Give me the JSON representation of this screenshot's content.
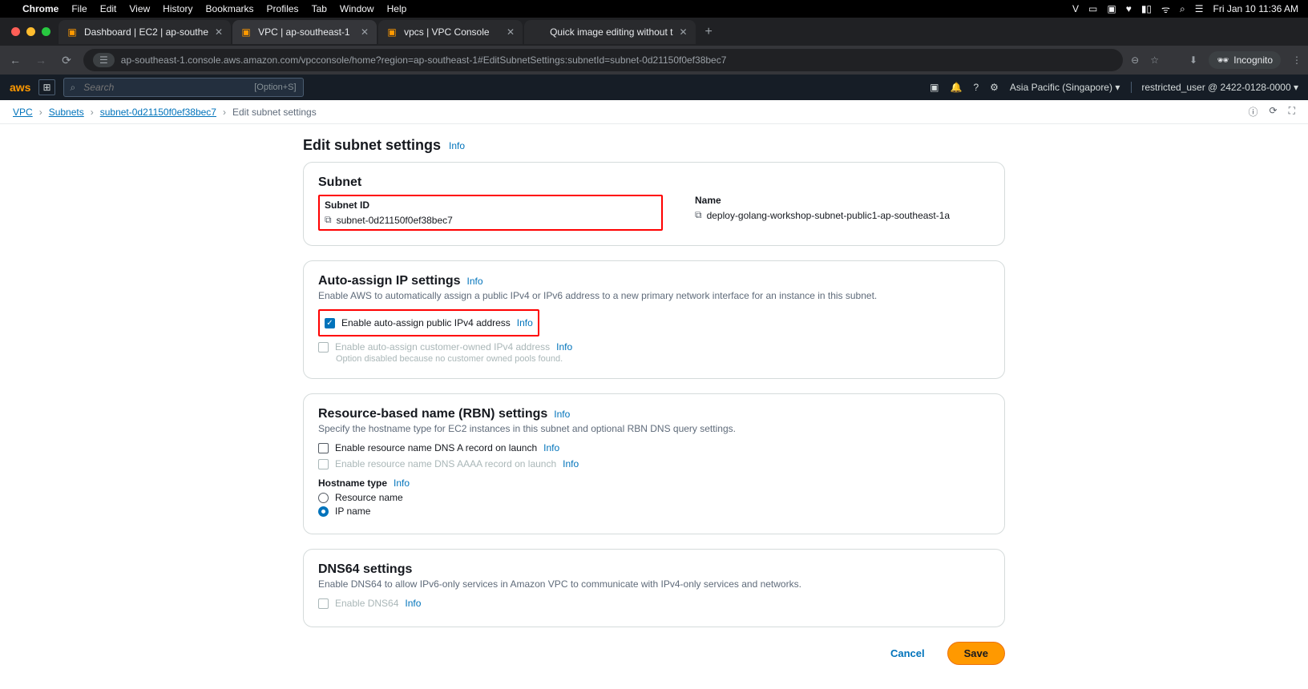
{
  "mac_menu": {
    "app_name": "Chrome",
    "items": [
      "File",
      "Edit",
      "View",
      "History",
      "Bookmarks",
      "Profiles",
      "Tab",
      "Window",
      "Help"
    ],
    "clock": "Fri Jan 10  11:36 AM"
  },
  "chrome": {
    "tabs": [
      {
        "title": "Dashboard | EC2 | ap-southe"
      },
      {
        "title": "VPC | ap-southeast-1"
      },
      {
        "title": "vpcs | VPC Console"
      },
      {
        "title": "Quick image editing without t"
      }
    ],
    "url": "ap-southeast-1.console.aws.amazon.com/vpcconsole/home?region=ap-southeast-1#EditSubnetSettings:subnetId=subnet-0d21150f0ef38bec7",
    "incognito_label": "Incognito"
  },
  "aws_header": {
    "search_placeholder": "Search",
    "shortcut": "[Option+S]",
    "region": "Asia Pacific (Singapore) ▾",
    "user": "restricted_user @ 2422-0128-0000 ▾"
  },
  "breadcrumb": {
    "items": [
      "VPC",
      "Subnets",
      "subnet-0d21150f0ef38bec7"
    ],
    "current": "Edit subnet settings"
  },
  "page": {
    "title": "Edit subnet settings",
    "info": "Info"
  },
  "subnet_panel": {
    "title": "Subnet",
    "id_label": "Subnet ID",
    "id_value": "subnet-0d21150f0ef38bec7",
    "name_label": "Name",
    "name_value": "deploy-golang-workshop-subnet-public1-ap-southeast-1a"
  },
  "autoip_panel": {
    "title": "Auto-assign IP settings",
    "desc": "Enable AWS to automatically assign a public IPv4 or IPv6 address to a new primary network interface for an instance in this subnet.",
    "cb1_label": "Enable auto-assign public IPv4 address",
    "cb2_label": "Enable auto-assign customer-owned IPv4 address",
    "cb2_hint": "Option disabled because no customer owned pools found.",
    "info": "Info"
  },
  "rbn_panel": {
    "title": "Resource-based name (RBN) settings",
    "desc": "Specify the hostname type for EC2 instances in this subnet and optional RBN DNS query settings.",
    "cb_a_record": "Enable resource name DNS A record on launch",
    "cb_aaaa_record": "Enable resource name DNS AAAA record on launch",
    "hostname_label": "Hostname type",
    "radio_resource": "Resource name",
    "radio_ip": "IP name",
    "info": "Info"
  },
  "dns64_panel": {
    "title": "DNS64 settings",
    "desc": "Enable DNS64 to allow IPv6-only services in Amazon VPC to communicate with IPv4-only services and networks.",
    "cb_label": "Enable DNS64",
    "info": "Info"
  },
  "actions": {
    "cancel": "Cancel",
    "save": "Save"
  }
}
